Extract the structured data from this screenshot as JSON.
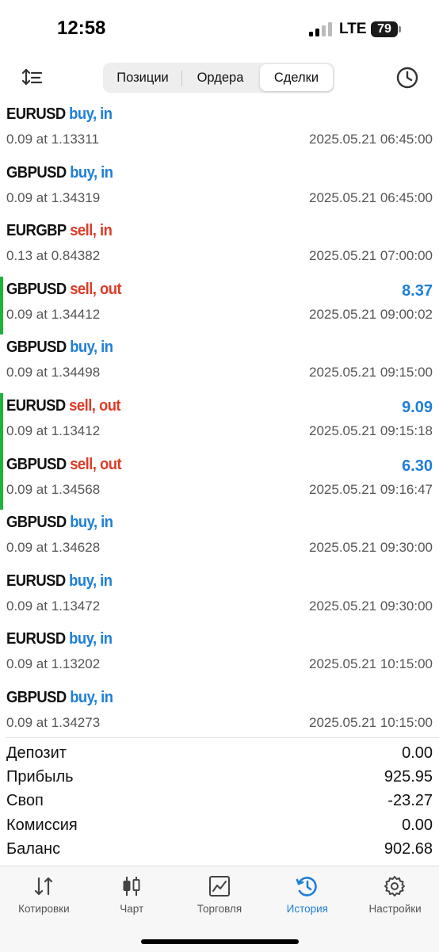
{
  "status_bar": {
    "time": "12:58",
    "network": "LTE",
    "battery": "79"
  },
  "toolbar": {
    "tabs": [
      {
        "label": "Позиции",
        "selected": false
      },
      {
        "label": "Ордера",
        "selected": false
      },
      {
        "label": "Сделки",
        "selected": true
      }
    ]
  },
  "deals": [
    {
      "symbol": "EURUSD",
      "action": "buy, in",
      "side": "buy",
      "volume_price": "0.09 at 1.13311",
      "time": "2025.05.21 06:45:00",
      "profit": "",
      "closed": false
    },
    {
      "symbol": "GBPUSD",
      "action": "buy, in",
      "side": "buy",
      "volume_price": "0.09 at 1.34319",
      "time": "2025.05.21 06:45:00",
      "profit": "",
      "closed": false
    },
    {
      "symbol": "EURGBP",
      "action": "sell, in",
      "side": "sell",
      "volume_price": "0.13 at 0.84382",
      "time": "2025.05.21 07:00:00",
      "profit": "",
      "closed": false
    },
    {
      "symbol": "GBPUSD",
      "action": "sell, out",
      "side": "sell",
      "volume_price": "0.09 at 1.34412",
      "time": "2025.05.21 09:00:02",
      "profit": "8.37",
      "closed": true
    },
    {
      "symbol": "GBPUSD",
      "action": "buy, in",
      "side": "buy",
      "volume_price": "0.09 at 1.34498",
      "time": "2025.05.21 09:15:00",
      "profit": "",
      "closed": false
    },
    {
      "symbol": "EURUSD",
      "action": "sell, out",
      "side": "sell",
      "volume_price": "0.09 at 1.13412",
      "time": "2025.05.21 09:15:18",
      "profit": "9.09",
      "closed": true
    },
    {
      "symbol": "GBPUSD",
      "action": "sell, out",
      "side": "sell",
      "volume_price": "0.09 at 1.34568",
      "time": "2025.05.21 09:16:47",
      "profit": "6.30",
      "closed": true
    },
    {
      "symbol": "GBPUSD",
      "action": "buy, in",
      "side": "buy",
      "volume_price": "0.09 at 1.34628",
      "time": "2025.05.21 09:30:00",
      "profit": "",
      "closed": false
    },
    {
      "symbol": "EURUSD",
      "action": "buy, in",
      "side": "buy",
      "volume_price": "0.09 at 1.13472",
      "time": "2025.05.21 09:30:00",
      "profit": "",
      "closed": false
    },
    {
      "symbol": "EURUSD",
      "action": "buy, in",
      "side": "buy",
      "volume_price": "0.09 at 1.13202",
      "time": "2025.05.21 10:15:00",
      "profit": "",
      "closed": false
    },
    {
      "symbol": "GBPUSD",
      "action": "buy, in",
      "side": "buy",
      "volume_price": "0.09 at 1.34273",
      "time": "2025.05.21 10:15:00",
      "profit": "",
      "closed": false
    }
  ],
  "summary": [
    {
      "label": "Депозит",
      "value": "0.00"
    },
    {
      "label": "Прибыль",
      "value": "925.95"
    },
    {
      "label": "Своп",
      "value": "-23.27"
    },
    {
      "label": "Комиссия",
      "value": "0.00"
    },
    {
      "label": "Баланс",
      "value": "902.68"
    }
  ],
  "tabbar": [
    {
      "label": "Котировки",
      "icon": "quotes-icon",
      "active": false
    },
    {
      "label": "Чарт",
      "icon": "chart-icon",
      "active": false
    },
    {
      "label": "Торговля",
      "icon": "trade-icon",
      "active": false
    },
    {
      "label": "История",
      "icon": "history-icon",
      "active": true
    },
    {
      "label": "Настройки",
      "icon": "settings-icon",
      "active": false
    }
  ],
  "colors": {
    "accent": "#1e7fd8",
    "sell": "#dd3b26",
    "closed_marker": "#1db33c"
  }
}
